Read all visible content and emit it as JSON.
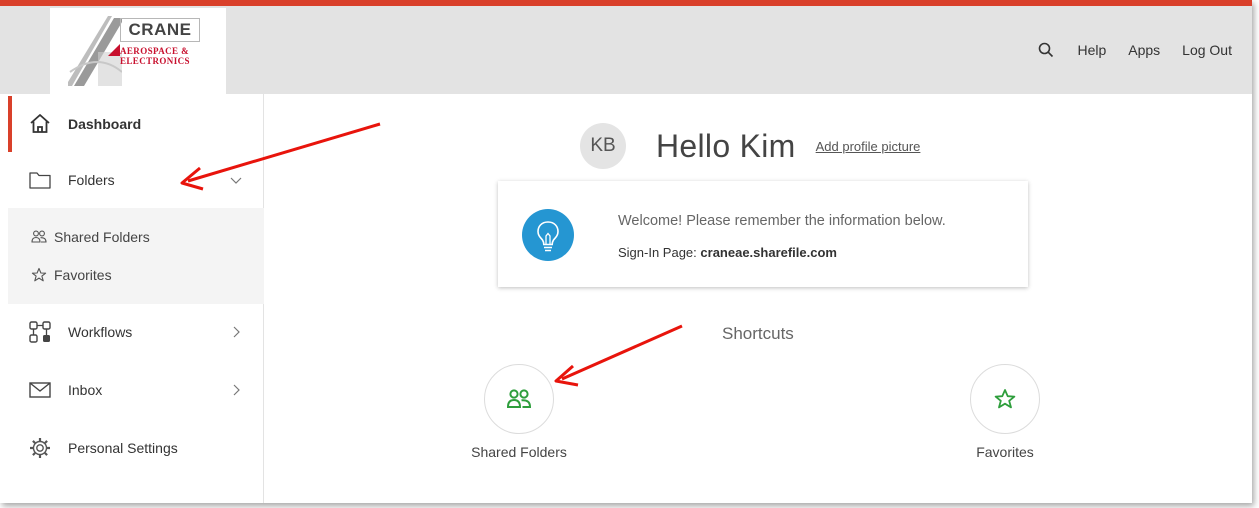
{
  "brand": {
    "logo_name": "CRANE",
    "logo_sub_line1": "AEROSPACE &",
    "logo_sub_line2": "ELECTRONICS",
    "accent_color": "#d9402a"
  },
  "header": {
    "search_icon": "search-icon",
    "links": [
      "Help",
      "Apps",
      "Log Out"
    ]
  },
  "sidebar": {
    "items": [
      {
        "label": "Dashboard",
        "icon": "home-icon"
      },
      {
        "label": "Folders",
        "icon": "folder-icon"
      },
      {
        "label": "Workflows",
        "icon": "workflows-icon"
      },
      {
        "label": "Inbox",
        "icon": "mail-icon"
      },
      {
        "label": "Personal Settings",
        "icon": "gear-icon"
      }
    ],
    "subitems": [
      {
        "label": "Shared Folders",
        "icon": "people-icon"
      },
      {
        "label": "Favorites",
        "icon": "star-icon"
      }
    ]
  },
  "main": {
    "avatar_initials": "KB",
    "greeting": "Hello Kim",
    "add_profile_picture": "Add profile picture",
    "welcome_text": "Welcome! Please remember the information below.",
    "signin_label": "Sign-In Page:",
    "signin_value": "craneae.sharefile.com",
    "shortcuts_title": "Shortcuts",
    "shortcuts": [
      {
        "label": "Shared Folders",
        "icon": "people-icon"
      },
      {
        "label": "Favorites",
        "icon": "star-icon"
      }
    ],
    "shortcut_icon_color": "#2e9e3c",
    "info_icon_color": "#2596d2"
  },
  "annotations": {
    "arrow_color": "#e8140c"
  }
}
